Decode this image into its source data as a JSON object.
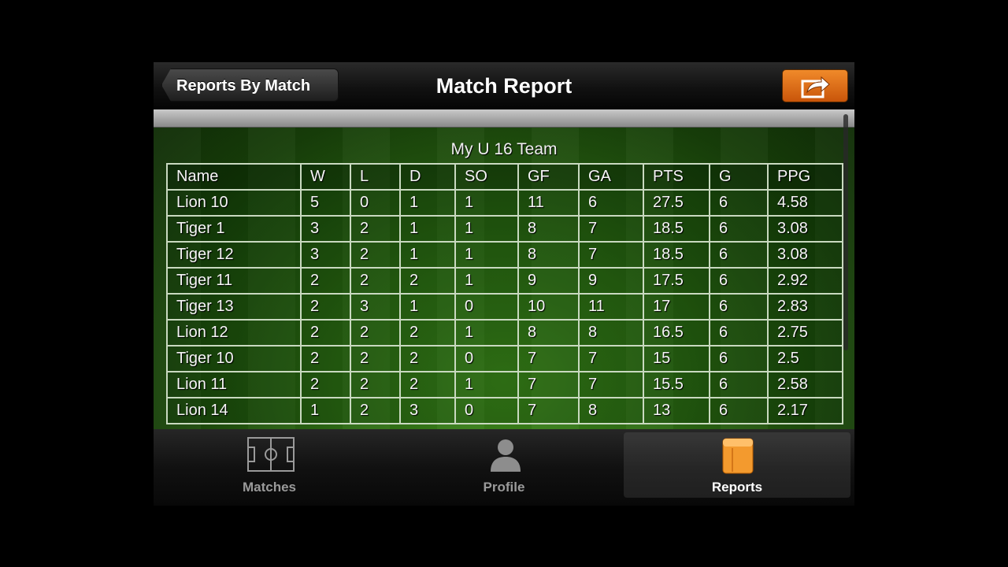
{
  "navbar": {
    "back_label": "Reports By Match",
    "title": "Match Report",
    "share_icon": "share-icon"
  },
  "report": {
    "team_name": "My U 16 Team",
    "columns": [
      "Name",
      "W",
      "L",
      "D",
      "SO",
      "GF",
      "GA",
      "PTS",
      "G",
      "PPG"
    ],
    "rows": [
      [
        "Lion 10",
        "5",
        "0",
        "1",
        "1",
        "11",
        "6",
        "27.5",
        "6",
        "4.58"
      ],
      [
        "Tiger 1",
        "3",
        "2",
        "1",
        "1",
        "8",
        "7",
        "18.5",
        "6",
        "3.08"
      ],
      [
        "Tiger 12",
        "3",
        "2",
        "1",
        "1",
        "8",
        "7",
        "18.5",
        "6",
        "3.08"
      ],
      [
        "Tiger 11",
        "2",
        "2",
        "2",
        "1",
        "9",
        "9",
        "17.5",
        "6",
        "2.92"
      ],
      [
        "Tiger 13",
        "2",
        "3",
        "1",
        "0",
        "10",
        "11",
        "17",
        "6",
        "2.83"
      ],
      [
        "Lion 12",
        "2",
        "2",
        "2",
        "1",
        "8",
        "8",
        "16.5",
        "6",
        "2.75"
      ],
      [
        "Tiger 10",
        "2",
        "2",
        "2",
        "0",
        "7",
        "7",
        "15",
        "6",
        "2.5"
      ],
      [
        "Lion 11",
        "2",
        "2",
        "2",
        "1",
        "7",
        "7",
        "15.5",
        "6",
        "2.58"
      ],
      [
        "Lion 14",
        "1",
        "2",
        "3",
        "0",
        "7",
        "8",
        "13",
        "6",
        "2.17"
      ]
    ]
  },
  "tabbar": {
    "tabs": [
      {
        "label": "Matches",
        "icon": "soccer-field-icon",
        "active": false
      },
      {
        "label": "Profile",
        "icon": "person-icon",
        "active": false
      },
      {
        "label": "Reports",
        "icon": "notebook-icon",
        "active": true
      }
    ]
  },
  "colors": {
    "accent_orange": "#e07018",
    "field_green": "#2d6a14"
  }
}
